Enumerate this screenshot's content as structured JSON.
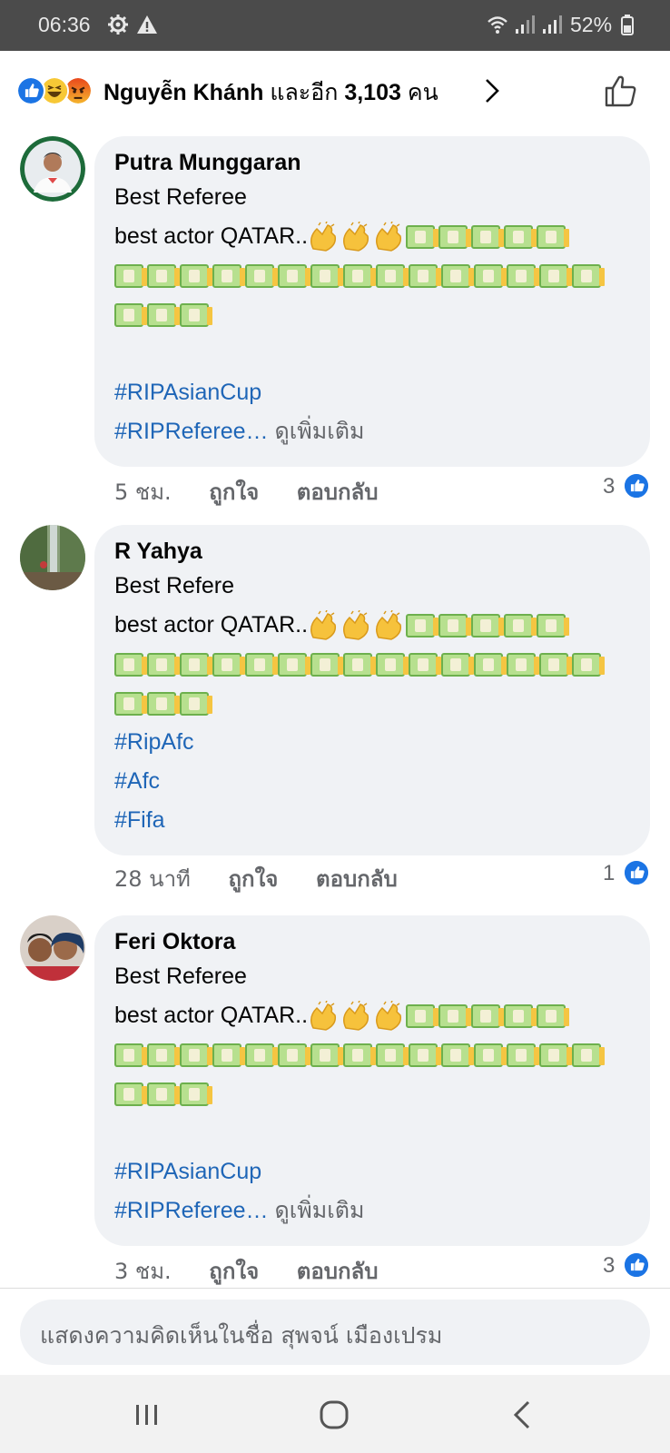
{
  "status_bar": {
    "time": "06:36",
    "battery": "52%",
    "icons": [
      "settings-gear-icon",
      "warning-triangle-icon",
      "wifi-icon",
      "signal-icon",
      "signal-icon",
      "battery-icon"
    ]
  },
  "reactions": {
    "icons": [
      "like-icon",
      "haha-icon",
      "angry-icon"
    ],
    "name": "Nguyễn Khánh",
    "connector": "และอีก",
    "count": "3,103",
    "unit": "คน"
  },
  "comments": [
    {
      "author": "Putra Munggaran",
      "line1": "Best Referee",
      "text_prefix": "best actor QATAR..",
      "hashtags": [
        "#RIPAsianCup",
        "#RIPReferee…"
      ],
      "see_more": "ดูเพิ่มเติม",
      "time": "5 ชม.",
      "like_action": "ถูกใจ",
      "reply_action": "ตอบกลับ",
      "like_count": "3"
    },
    {
      "author": "R Yahya",
      "line1": "Best Refere",
      "text_prefix": "best actor QATAR..",
      "hashtags": [
        "#RipAfc",
        "#Afc",
        "#Fifa"
      ],
      "time": "28 นาที",
      "like_action": "ถูกใจ",
      "reply_action": "ตอบกลับ",
      "like_count": "1"
    },
    {
      "author": "Feri Oktora",
      "line1": "Best Referee",
      "text_prefix": "best actor QATAR..",
      "hashtags": [
        "#RIPAsianCup",
        "#RIPReferee…"
      ],
      "see_more": "ดูเพิ่มเติม",
      "time": "3 ชม.",
      "like_action": "ถูกใจ",
      "reply_action": "ตอบกลับ",
      "like_count": "3"
    }
  ],
  "composer": {
    "placeholder": "แสดงความคิดเห็นในชื่อ สุพจน์ เมืองเปรม"
  },
  "navigation": [
    "recent-apps-icon",
    "home-icon",
    "back-icon"
  ]
}
